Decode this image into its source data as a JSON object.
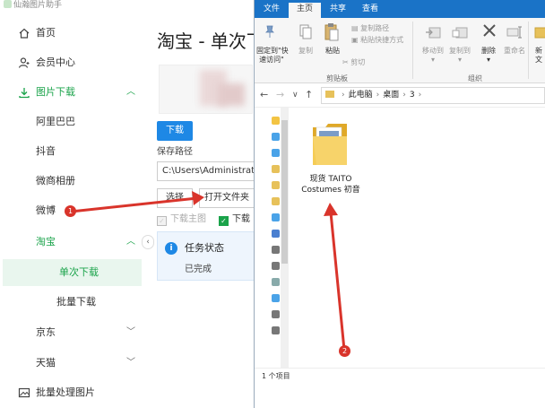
{
  "app": {
    "title": "仙瀚图片助手",
    "nav": [
      {
        "label": "首页",
        "icon": "home-icon"
      },
      {
        "label": "会员中心",
        "icon": "user-icon"
      },
      {
        "label": "图片下载",
        "icon": "download-icon"
      },
      {
        "label": "阿里巴巴"
      },
      {
        "label": "抖音"
      },
      {
        "label": "微商相册"
      },
      {
        "label": "微博"
      },
      {
        "label": "淘宝"
      },
      {
        "label": "单次下载"
      },
      {
        "label": "批量下载"
      },
      {
        "label": "京东"
      },
      {
        "label": "天猫"
      },
      {
        "label": "批量处理图片",
        "icon": "image-icon"
      }
    ],
    "main": {
      "title": "淘宝 - 单次下载",
      "download_button": "下载",
      "save_path_label": "保存路径",
      "save_path_value": "C:\\Users\\Administrator",
      "choose_button": "选择",
      "open_folder_button": "打开文件夹",
      "checkbox_main_image": "下载主图",
      "checkbox_detail": "下载",
      "status_title": "任务状态",
      "status_value": "已完成"
    }
  },
  "explorer": {
    "menu_tabs": [
      "文件",
      "主页",
      "共享",
      "查看"
    ],
    "ribbon": {
      "pin_quick_access": "固定到\"快\n速访问\"",
      "copy": "复制",
      "paste": "粘贴",
      "copy_path": "复制路径",
      "paste_shortcut": "粘贴快捷方式",
      "cut": "剪切",
      "clipboard_group": "剪贴板",
      "move_to": "移动到",
      "copy_to": "复制到",
      "delete": "删除",
      "rename": "重命名",
      "organize_group": "组织",
      "new_folder_partial": "新",
      "new_folder_partial2": "文"
    },
    "breadcrumb": [
      "此电脑",
      "桌面",
      "3"
    ],
    "folder_name": "现货 TAITO\nCostumes 初音",
    "status_count": "1 个项目"
  },
  "annotations": [
    {
      "number": "1"
    },
    {
      "number": "2"
    }
  ],
  "colors": {
    "accent_green": "#1aa34a",
    "accent_blue": "#1e88e5",
    "explorer_blue": "#1a73c7",
    "arrow_red": "#d9342b"
  }
}
